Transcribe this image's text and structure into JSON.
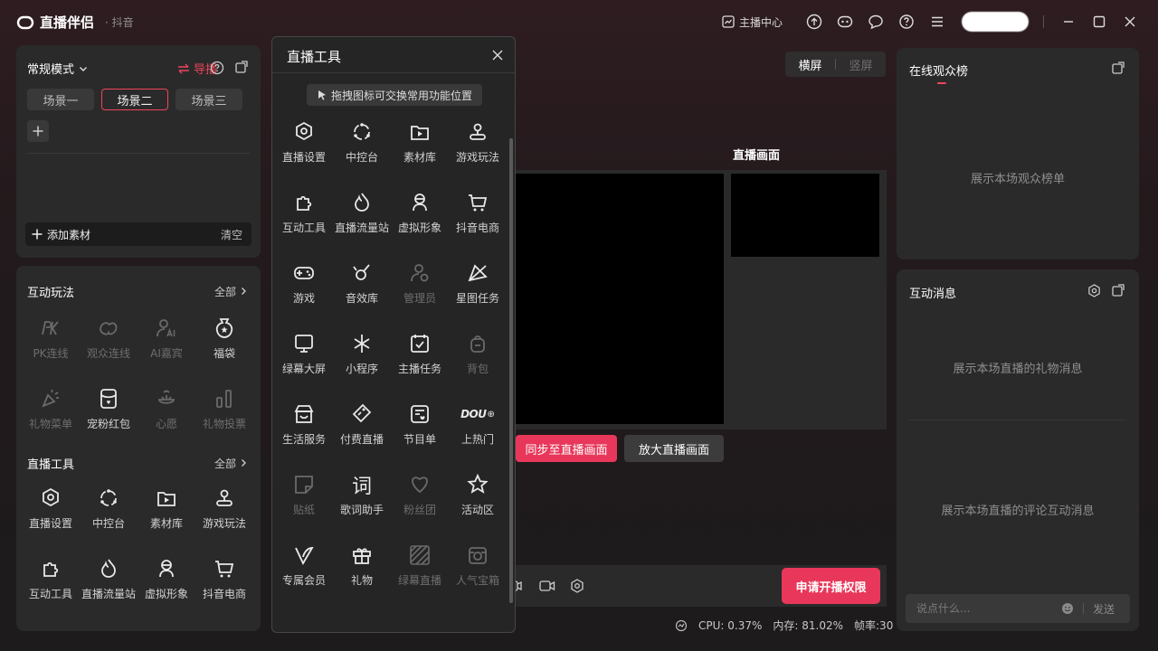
{
  "app": {
    "name": "直播伴侣",
    "platform": "· 抖音"
  },
  "topbar": {
    "live_center": "主播中心"
  },
  "scene_panel": {
    "mode": "常规模式",
    "guide": "导播",
    "scenes": [
      "场景一",
      "场景二",
      "场景三"
    ],
    "active_scene": "场景二",
    "add_material": "添加素材",
    "clear": "清空"
  },
  "interactive": {
    "title": "互动玩法",
    "all": "全部",
    "items": [
      {
        "label": "PK连线",
        "icon": "pk-icon",
        "enabled": false
      },
      {
        "label": "观众连线",
        "icon": "audience-link-icon",
        "enabled": false
      },
      {
        "label": "AI嘉宾",
        "icon": "ai-guest-icon",
        "enabled": false
      },
      {
        "label": "福袋",
        "icon": "lucky-bag-icon",
        "enabled": true
      },
      {
        "label": "礼物菜单",
        "icon": "gift-menu-icon",
        "enabled": false
      },
      {
        "label": "宠粉红包",
        "icon": "fan-red-packet-icon",
        "enabled": true
      },
      {
        "label": "心愿",
        "icon": "wish-icon",
        "enabled": false
      },
      {
        "label": "礼物投票",
        "icon": "gift-vote-icon",
        "enabled": false
      }
    ]
  },
  "tools": {
    "title": "直播工具",
    "all": "全部",
    "items": [
      {
        "label": "直播设置",
        "icon": "live-settings-icon"
      },
      {
        "label": "中控台",
        "icon": "control-center-icon"
      },
      {
        "label": "素材库",
        "icon": "material-library-icon"
      },
      {
        "label": "游戏玩法",
        "icon": "game-play-icon"
      },
      {
        "label": "互动工具",
        "icon": "interactive-tools-icon"
      },
      {
        "label": "直播流量站",
        "icon": "traffic-station-icon"
      },
      {
        "label": "虚拟形象",
        "icon": "virtual-avatar-icon"
      },
      {
        "label": "抖音电商",
        "icon": "douyin-shop-icon"
      }
    ]
  },
  "popup": {
    "title": "直播工具",
    "hint": "拖拽图标可交换常用功能位置",
    "items": [
      {
        "label": "直播设置",
        "icon": "live-settings-icon",
        "enabled": true
      },
      {
        "label": "中控台",
        "icon": "control-center-icon",
        "enabled": true
      },
      {
        "label": "素材库",
        "icon": "material-library-icon",
        "enabled": true
      },
      {
        "label": "游戏玩法",
        "icon": "game-play-icon",
        "enabled": true
      },
      {
        "label": "互动工具",
        "icon": "interactive-tools-icon",
        "enabled": true
      },
      {
        "label": "直播流量站",
        "icon": "traffic-station-icon",
        "enabled": true
      },
      {
        "label": "虚拟形象",
        "icon": "virtual-avatar-icon",
        "enabled": true
      },
      {
        "label": "抖音电商",
        "icon": "douyin-shop-icon",
        "enabled": true
      },
      {
        "label": "游戏",
        "icon": "gamepad-icon",
        "enabled": true
      },
      {
        "label": "音效库",
        "icon": "sound-effects-icon",
        "enabled": true
      },
      {
        "label": "管理员",
        "icon": "admin-icon",
        "enabled": false
      },
      {
        "label": "星图任务",
        "icon": "star-map-task-icon",
        "enabled": true
      },
      {
        "label": "绿幕大屏",
        "icon": "green-screen-icon",
        "enabled": true
      },
      {
        "label": "小程序",
        "icon": "mini-program-icon",
        "enabled": true
      },
      {
        "label": "主播任务",
        "icon": "streamer-task-icon",
        "enabled": true
      },
      {
        "label": "背包",
        "icon": "backpack-icon",
        "enabled": false
      },
      {
        "label": "生活服务",
        "icon": "life-service-icon",
        "enabled": true
      },
      {
        "label": "付费直播",
        "icon": "paid-live-icon",
        "enabled": true
      },
      {
        "label": "节目单",
        "icon": "program-list-icon",
        "enabled": true
      },
      {
        "label": "上热门",
        "icon": "dou-plus-icon",
        "enabled": true,
        "glyph": "DOU"
      },
      {
        "label": "贴纸",
        "icon": "sticker-icon",
        "enabled": false
      },
      {
        "label": "歌词助手",
        "icon": "lyrics-icon",
        "enabled": true,
        "glyph": "词"
      },
      {
        "label": "粉丝团",
        "icon": "fan-club-icon",
        "enabled": false
      },
      {
        "label": "活动区",
        "icon": "activity-star-icon",
        "enabled": true
      },
      {
        "label": "专属会员",
        "icon": "vip-member-icon",
        "enabled": true
      },
      {
        "label": "礼物",
        "icon": "gift-icon",
        "enabled": true
      },
      {
        "label": "绿幕直播",
        "icon": "green-screen-live-icon",
        "enabled": false
      },
      {
        "label": "人气宝箱",
        "icon": "treasure-box-icon",
        "enabled": false
      }
    ]
  },
  "center": {
    "orientation": {
      "landscape": "横屏",
      "portrait": "竖屏"
    },
    "preview_title": "直播画面",
    "sync_button": "同步至直播画面",
    "zoom_button": "放大直播画面",
    "apply_button": "申请开播权限"
  },
  "status": {
    "cpu": "CPU: 0.37%",
    "memory": "内存: 81.02%",
    "fps": "帧率:30"
  },
  "rank": {
    "title": "在线观众榜",
    "empty": "展示本场观众榜单"
  },
  "messages": {
    "title": "互动消息",
    "gift_empty": "展示本场直播的礼物消息",
    "comment_empty": "展示本场直播的评论互动消息",
    "placeholder": "说点什么...",
    "send": "发送"
  },
  "colors": {
    "accent": "#e8375a",
    "panel": "#2b2a2b",
    "background": "#1d1b1c"
  }
}
